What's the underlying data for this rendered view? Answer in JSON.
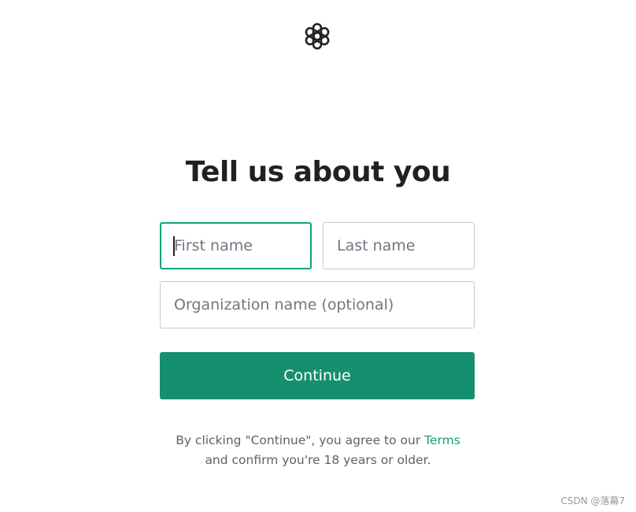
{
  "brand": {
    "logo_icon": "openai-logo-icon",
    "accent_color": "#10a37f",
    "button_color": "#168f6f"
  },
  "heading": {
    "title": "Tell us about you"
  },
  "form": {
    "first_name": {
      "placeholder": "First name",
      "value": ""
    },
    "last_name": {
      "placeholder": "Last name",
      "value": ""
    },
    "organization": {
      "placeholder": "Organization name (optional)",
      "value": ""
    },
    "continue_label": "Continue"
  },
  "legal": {
    "prefix": "By clicking \"Continue\", you agree to our",
    "terms_link": "Terms",
    "line2": "and confirm you're 18 years or older."
  },
  "watermark": {
    "text": "CSDN @落幕7"
  }
}
